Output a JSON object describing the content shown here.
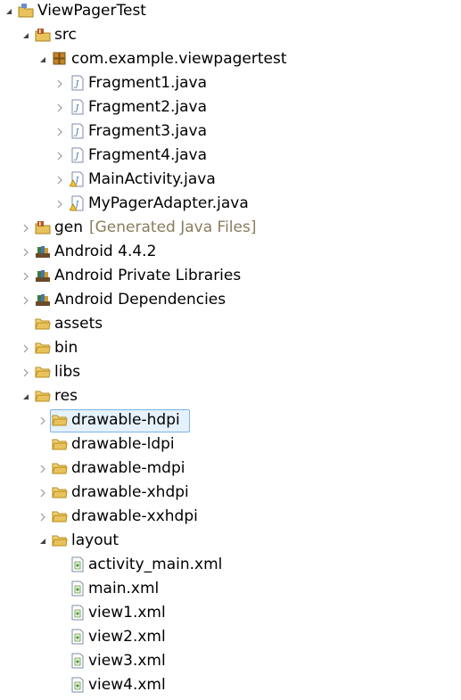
{
  "explorer": {
    "project": {
      "label": "ViewPagerTest",
      "icon": "project-folder-icon"
    },
    "src": {
      "label": "src",
      "icon": "source-folder-icon"
    },
    "package": {
      "label": "com.example.viewpagertest",
      "icon": "package-icon"
    },
    "java_files": [
      {
        "label": "Fragment1.java",
        "icon": "java-file-icon"
      },
      {
        "label": "Fragment2.java",
        "icon": "java-file-icon"
      },
      {
        "label": "Fragment3.java",
        "icon": "java-file-icon"
      },
      {
        "label": "Fragment4.java",
        "icon": "java-file-icon"
      },
      {
        "label": "MainActivity.java",
        "icon": "java-file-warning-icon"
      },
      {
        "label": "MyPagerAdapter.java",
        "icon": "java-file-warning-icon"
      }
    ],
    "gen": {
      "label": "gen",
      "decoration": "[Generated Java Files]",
      "icon": "source-folder-icon"
    },
    "libraries": [
      {
        "label": "Android 4.4.2",
        "icon": "library-icon"
      },
      {
        "label": "Android Private Libraries",
        "icon": "library-icon"
      },
      {
        "label": "Android Dependencies",
        "icon": "library-icon"
      }
    ],
    "folders": [
      {
        "label": "assets",
        "icon": "folder-icon"
      },
      {
        "label": "bin",
        "icon": "folder-icon"
      },
      {
        "label": "libs",
        "icon": "folder-icon"
      }
    ],
    "res": {
      "label": "res",
      "icon": "folder-icon"
    },
    "drawables": [
      {
        "label": "drawable-hdpi",
        "icon": "folder-icon",
        "selected": true
      },
      {
        "label": "drawable-ldpi",
        "icon": "folder-icon"
      },
      {
        "label": "drawable-mdpi",
        "icon": "folder-icon"
      },
      {
        "label": "drawable-xhdpi",
        "icon": "folder-icon"
      },
      {
        "label": "drawable-xxhdpi",
        "icon": "folder-icon"
      }
    ],
    "layout": {
      "label": "layout",
      "icon": "folder-icon"
    },
    "xml_files": [
      {
        "label": "activity_main.xml",
        "icon": "xml-file-icon"
      },
      {
        "label": "main.xml",
        "icon": "xml-file-icon"
      },
      {
        "label": "view1.xml",
        "icon": "xml-file-icon"
      },
      {
        "label": "view2.xml",
        "icon": "xml-file-icon"
      },
      {
        "label": "view3.xml",
        "icon": "xml-file-icon"
      },
      {
        "label": "view4.xml",
        "icon": "xml-file-icon"
      }
    ],
    "colors": {
      "decoration_text": "#8b7d5c",
      "selection_fill": "#e5f1fb",
      "selection_border": "#7eb4ea",
      "folder_yellow": "#e8c25a",
      "java_blue": "#3a6fb0",
      "xml_green": "#5a9a3a"
    }
  }
}
